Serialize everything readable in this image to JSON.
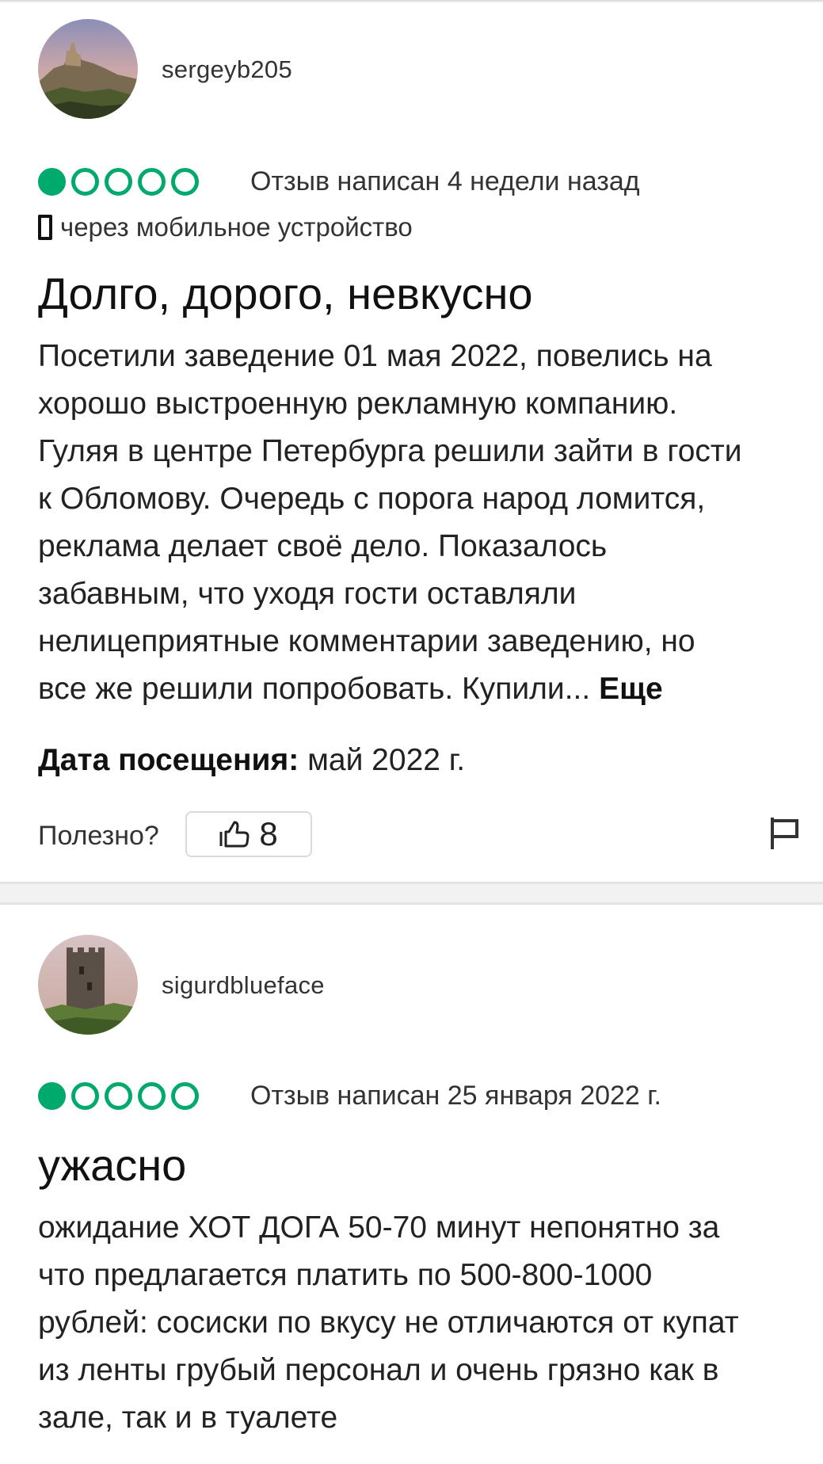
{
  "reviews": [
    {
      "username": "sergeyb205",
      "rating": 1,
      "rating_max": 5,
      "written": "Отзыв написан 4 недели назад",
      "device": "через мобильное устройство",
      "title": "Долго, дорого, невкусно",
      "body_lines": [
        "Посетили заведение 01 мая 2022, повелись на",
        "хорошо выстроенную рекламную компанию.",
        "Гуляя в центре Петербурга решили зайти в гости",
        "к Обломову. Очередь с порога народ ломится,",
        "реклама делает своё дело. Показалось",
        "забавным, что уходя гости оставляли",
        "нелицеприятные комментарии заведению, но",
        "все же решили попробовать. Купили..."
      ],
      "more_label": "Еще",
      "visit_label": "Дата посещения:",
      "visit_value": "май 2022 г.",
      "helpful_label": "Полезно?",
      "helpful_count": "8"
    },
    {
      "username": "sigurdblueface",
      "rating": 1,
      "rating_max": 5,
      "written": "Отзыв написан 25 января 2022 г.",
      "title": "ужасно",
      "body_lines": [
        "ожидание ХОТ ДОГА 50-70 минут непонятно за",
        "что предлагается платить по 500-800-1000",
        "рублей: сосиски по вкусу не отличаются от купат",
        "из ленты грубый персонал и очень грязно как в",
        "зале, так и в туалете"
      ]
    }
  ],
  "icons": {
    "bubble": "rating-bubble-icon",
    "phone": "mobile-phone-icon",
    "like": "thumbs-up-icon",
    "flag": "flag-icon"
  },
  "colors": {
    "rating_green": "#00aa6c",
    "text": "#222222",
    "divider": "#f2f2f2"
  }
}
